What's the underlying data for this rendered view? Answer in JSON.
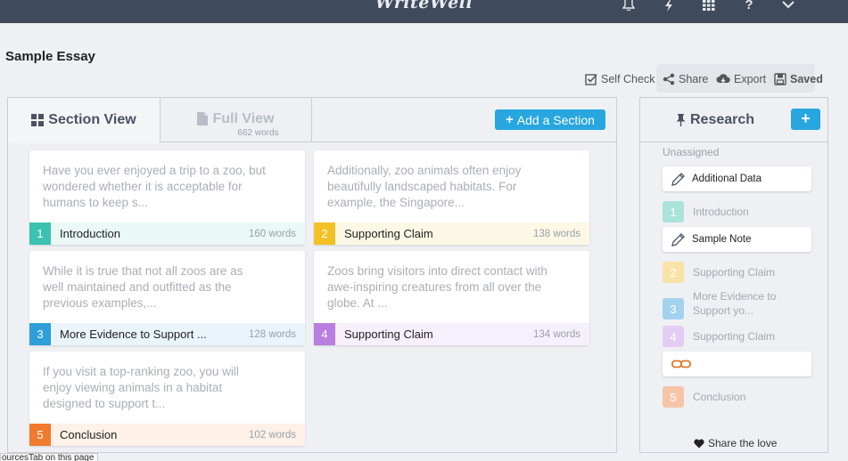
{
  "app": {
    "brand": "WriteWell"
  },
  "essay": {
    "title": "Sample Essay"
  },
  "toolbar": {
    "self_check": "Self Check",
    "share": "Share",
    "export": "Export",
    "saved": "Saved"
  },
  "tabs": {
    "section_view": "Section View",
    "full_view": "Full View",
    "full_view_words": "662 words"
  },
  "add_section": "Add a Section",
  "cards": [
    {
      "num": "1",
      "text": "Have you ever enjoyed a trip to a zoo, but wondered whether it is acceptable for humans to keep s...",
      "title": "Introduction",
      "words": "160 words",
      "color": "#3cc2b0",
      "foot": "#eaf8f6"
    },
    {
      "num": "2",
      "text": "Additionally, zoo animals often enjoy beautifully landscaped habitats. For example, the Singapore...",
      "title": "Supporting Claim",
      "words": "138 words",
      "color": "#f3c026",
      "foot": "#fdf8e6"
    },
    {
      "num": "3",
      "text": "While it is true that not all zoos are as well maintained and outfitted as the previous examples,...",
      "title": "More Evidence to Support ...",
      "words": "128 words",
      "color": "#2e9fd8",
      "foot": "#eaf4fb"
    },
    {
      "num": "4",
      "text": "Zoos bring visitors into direct contact with awe-inspiring creatures from all over the globe. At ...",
      "title": "Supporting Claim",
      "words": "134 words",
      "color": "#b97fe0",
      "foot": "#f6effc"
    },
    {
      "num": "5",
      "text": "If you visit a top-ranking zoo, you will enjoy viewing animals in a habitat designed to support t...",
      "title": "Conclusion",
      "words": "102 words",
      "color": "#f07a2e",
      "foot": "#fdf1e8"
    }
  ],
  "research": {
    "title": "Research",
    "unassigned": "Unassigned",
    "notes": [
      "Additional Data",
      "Sample Note"
    ],
    "items": [
      {
        "num": "1",
        "label": "Introduction",
        "color": "#a9e3da"
      },
      {
        "num": "2",
        "label": "Supporting Claim",
        "color": "#f8e3a6"
      },
      {
        "num": "3",
        "label": "More Evidence to Support yo...",
        "color": "#a3d2ee"
      },
      {
        "num": "4",
        "label": "Supporting Claim",
        "color": "#e4cdf4"
      },
      {
        "num": "5",
        "label": "Conclusion",
        "color": "#f6c5a8"
      }
    ],
    "share_love": "Share the love"
  },
  "status_tip": "ourcesTab on this page"
}
